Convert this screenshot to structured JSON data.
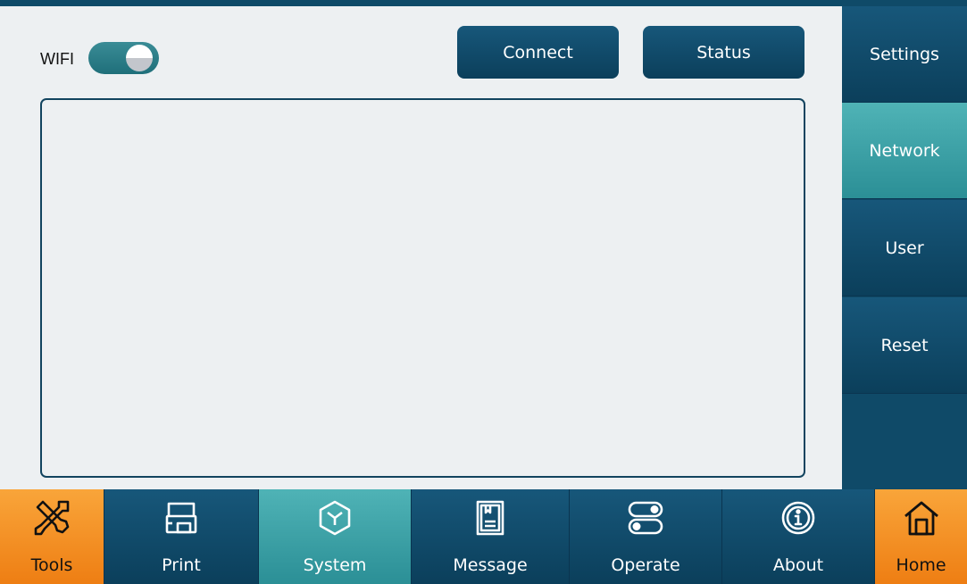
{
  "wifi": {
    "label": "WIFI",
    "enabled": true
  },
  "actions": {
    "connect": "Connect",
    "status": "Status"
  },
  "sidebar": {
    "items": [
      {
        "label": "Settings",
        "active": false
      },
      {
        "label": "Network",
        "active": true
      },
      {
        "label": "User",
        "active": false
      },
      {
        "label": "Reset",
        "active": false
      }
    ]
  },
  "nav": {
    "items": [
      {
        "label": "Tools",
        "icon": "tools-icon"
      },
      {
        "label": "Print",
        "icon": "printer-icon"
      },
      {
        "label": "System",
        "icon": "system-cube-icon",
        "active": true
      },
      {
        "label": "Message",
        "icon": "message-book-icon"
      },
      {
        "label": "Operate",
        "icon": "operate-toggles-icon"
      },
      {
        "label": "About",
        "icon": "info-icon"
      },
      {
        "label": "Home",
        "icon": "home-icon"
      }
    ]
  },
  "colors": {
    "navy": "#0e4a68",
    "teal_active": "#3aa3a8",
    "orange": "#f59322",
    "panel_bg": "#edf0f2"
  }
}
